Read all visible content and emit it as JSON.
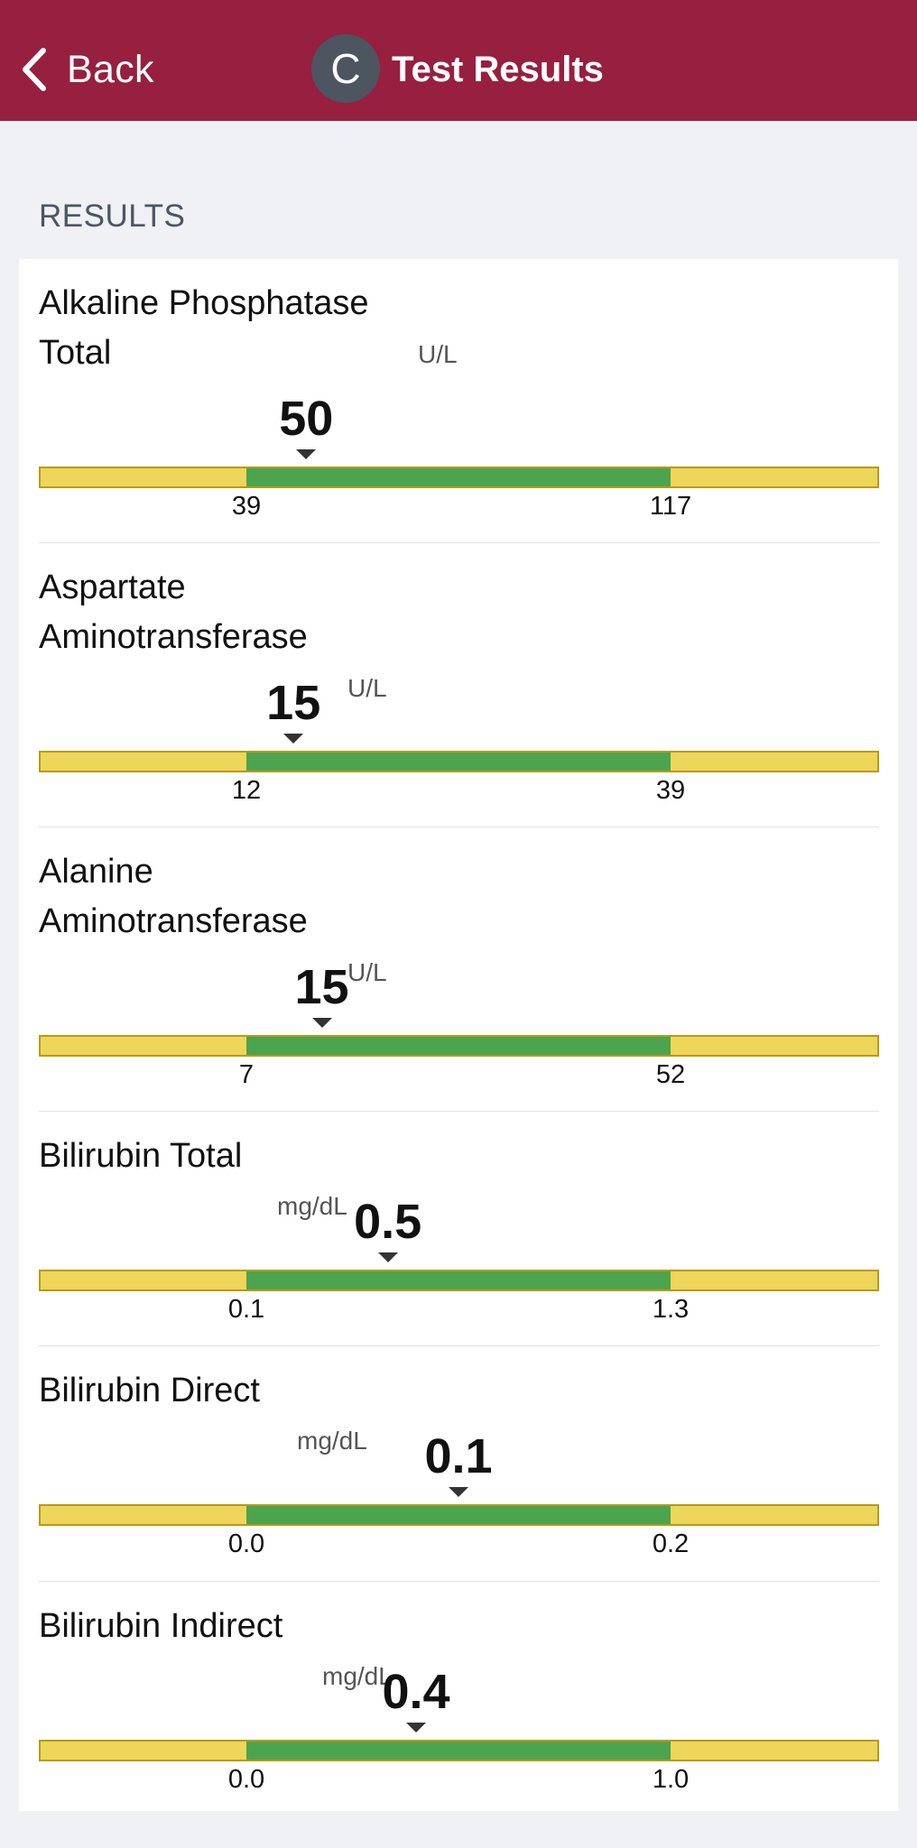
{
  "header": {
    "back_label": "Back",
    "avatar_initial": "C",
    "title": "Test Results",
    "background": "#971f40"
  },
  "section_label": "RESULTS",
  "colors": {
    "normal_range": "#4ca44e",
    "out_of_range": "#edd65a"
  },
  "results": [
    {
      "name_lines": [
        "Alkaline Phosphatase",
        "Total"
      ],
      "unit": "U/L",
      "value": "50",
      "low": "39",
      "high": "117"
    },
    {
      "name_lines": [
        "Aspartate",
        "Aminotransferase"
      ],
      "unit": "U/L",
      "value": "15",
      "low": "12",
      "high": "39"
    },
    {
      "name_lines": [
        "Alanine",
        "Aminotransferase"
      ],
      "unit": "U/L",
      "value": "15",
      "low": "7",
      "high": "52"
    },
    {
      "name_lines": [
        "Bilirubin Total"
      ],
      "unit": "mg/dL",
      "value": "0.5",
      "low": "0.1",
      "high": "1.3"
    },
    {
      "name_lines": [
        "Bilirubin Direct"
      ],
      "unit": "mg/dL",
      "value": "0.1",
      "low": "0.0",
      "high": "0.2"
    },
    {
      "name_lines": [
        "Bilirubin Indirect"
      ],
      "unit": "mg/dL",
      "value": "0.4",
      "low": "0.0",
      "high": "1.0"
    }
  ]
}
